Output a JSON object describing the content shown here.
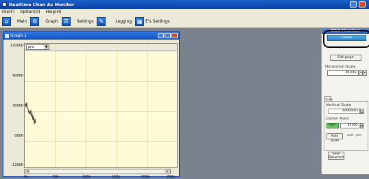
{
  "window": {
    "title": "Realtime Chan As Monitor"
  },
  "menu": [
    "File(F)",
    "Option(O)",
    "Help(H)"
  ],
  "toolbar": {
    "items": [
      {
        "label": "Main",
        "glyph": "⚙"
      },
      {
        "label": "Graph",
        "glyph": "☰"
      },
      {
        "label": "Settings",
        "glyph": "✎"
      },
      {
        "label": "Logging",
        "glyph": "▦"
      }
    ],
    "extra_label": "E's Settings"
  },
  "graph_window": {
    "title": "Graph 1",
    "unit_select": "pre.",
    "y_ticks": [
      "120000",
      "90000",
      "30000",
      "-3000",
      "-12000"
    ],
    "x_ticks": [
      "0s",
      "50s",
      "100s",
      "150s",
      "200s",
      "250s"
    ]
  },
  "panel": {
    "header": "BCA Monitor",
    "graph_button": "Graph",
    "edit_graph_button": "Edit graph",
    "horizontal_scale_label": "Horizontal Scale",
    "horizontal_scale_value": "80s/div",
    "tab_label": "Scale",
    "vertical_scale_label": "Vertical Scale",
    "vertical_scale_value": "60000/div",
    "center_point_label": "Center Point",
    "center_point_badge": "PWT",
    "center_point_value": "30100",
    "auto_scale_button": "Auto Scale",
    "unit_text": "unit : pre.",
    "save_button": "Save Document"
  }
}
